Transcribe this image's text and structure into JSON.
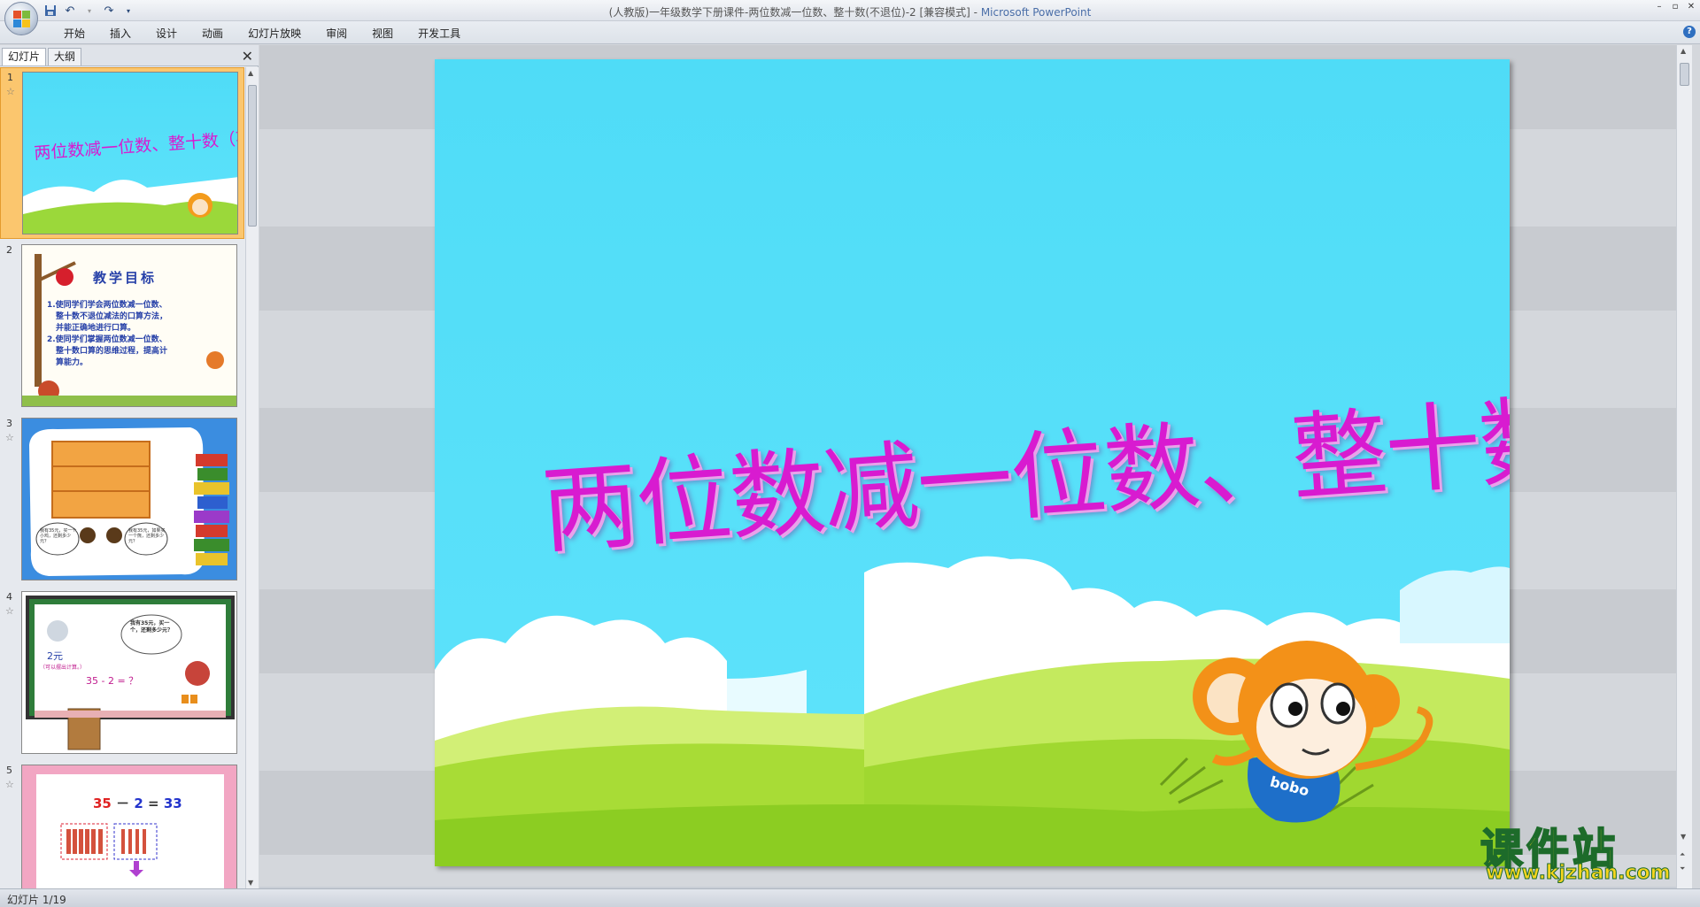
{
  "window": {
    "title_prefix": "(人教版)一年级数学下册课件-两位数减一位数、整十数(不退位)-2 [兼容模式] - ",
    "app_name": "Microsoft PowerPoint",
    "controls": [
      "–",
      "▫",
      "✕"
    ]
  },
  "quick_access": {
    "save_icon": "save-icon",
    "undo_icon": "undo-icon",
    "redo_icon": "redo-icon"
  },
  "ribbon": {
    "tabs": [
      "开始",
      "插入",
      "设计",
      "动画",
      "幻灯片放映",
      "审阅",
      "视图",
      "开发工具"
    ],
    "help": "?"
  },
  "panel": {
    "tab_slides": "幻灯片",
    "tab_outline": "大纲",
    "close": "✕"
  },
  "thumbnails": [
    {
      "num": "1",
      "title": "两位数减一位数、整十数（不退位）"
    },
    {
      "num": "2",
      "heading": "教学目标",
      "lines": [
        "1.使同学们学会两位数减一位数、",
        "整十数不退位减法的口算方法，",
        "并能正确地进行口算。",
        "2.使同学们掌握两位数减一位数、",
        "整十数口算的思维过程，提高计",
        "算能力。"
      ]
    },
    {
      "num": "3",
      "bubble_left": "我有35元，买一个小鸡，还剩多少元？",
      "bubble_right": "我有35元，如果买一个熊，还剩多少元？"
    },
    {
      "num": "4",
      "bubble": "我有35元，买一个，还剩多少元？",
      "price": "2元",
      "hint": "（可以摆出计算。）",
      "equation": "35 - 2 = ？"
    },
    {
      "num": "5",
      "equation_a": "35",
      "equation_op": "－",
      "equation_b": "2",
      "equation_eq": "=",
      "equation_c": "33"
    }
  ],
  "slide": {
    "title": "两位数减一位数、整十数（不退位）",
    "mascot_label": "bobo"
  },
  "status": {
    "slide_info": "幻灯片 1/19"
  },
  "watermark": {
    "title": "课件站",
    "url": "www.kjzhan.com"
  }
}
